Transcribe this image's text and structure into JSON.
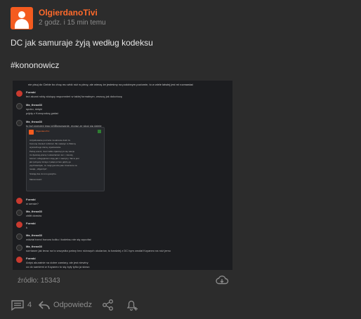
{
  "post": {
    "author": "OlgierdanoTivi",
    "time": "2 godz. i 15 min temu",
    "text": "DC jak samuraje żyją według kodeksu",
    "tag": "#kononowicz",
    "source": "źródło: 15343"
  },
  "screenshot": {
    "header": "nie pisuj do Cieble bo chcę mu wbić nóż w plecy, ale wierzę że jesteśmy na podobnym poziomie, to w wiele łatwiej jest mi rozmawiać",
    "messages": [
      {
        "author": "Formbi",
        "lines": [
          "też akurat robię służący wspomnień w takiej formalnym, wrzucę jak dokończę"
        ]
      },
      {
        "author": "Ma_theoa33",
        "lines": [
          "spoko, dzięki",
          "pójdę z Konopodzą gadać"
        ]
      },
      {
        "author": "Ma_theoa33",
        "lines": [
          "to był przecież jego ichBlowowanie, moraz ze skoć się dzieje"
        ]
      },
      {
        "author": "Formbi",
        "lines": [
          "w sensie?"
        ]
      },
      {
        "author": "Ma_theoa33",
        "lines": [
          "chłitt domów"
        ]
      },
      {
        "author": "Formbi",
        "lines": [
          "k"
        ]
      },
      {
        "author": "Ma_theoa33",
        "lines": [
          "widział trzeci honoru kolku i kodeksu nie się wycofać"
        ]
      },
      {
        "author": "Ma_theoa33",
        "lines": [
          "sorriasne jak teraz na to wszystko patrzy bez różowych okularów, to bardziej z DC bym zwołał Koyaneo na nóż jemu"
        ]
      },
      {
        "author": "Formbi",
        "lines": [
          "Antyś akuratnie na dobre zamiary, ale jest niewiny",
          "co do samiemi w Koyaneo to się były tylko ja słowo"
        ]
      }
    ],
    "quote": {
      "author": "OlgierdanoTivi",
      "lines": [
        "Antyśdowanie poczucie na akcesie dotór że",
        "Komunę również rozliczeń. Bo naświęc to Wiłomy",
        "wyszedł tego dumą, wyartowania.",
        "Pełnej anonii, rzecz kólko cijaścią tym się wiecje",
        "za dywanej-pracą z uwiaszaniem ten i, niesoty,",
        "bokruz i szłegojaniem stoję jak z maszyny. Tak to jest",
        "jak tycisywą mimigo z jakąć-przeto gdyby go",
        "psychotantyku, co mógł gonuzie jako znaszenie na",
        "reeaje, „objęsniya\".",
        "",
        "Szałuję tkie do toru gosiybre.",
        "",
        "Marcenowicz"
      ]
    }
  },
  "actions": {
    "comments_count": "4",
    "reply_label": "Odpowiedz"
  },
  "colors": {
    "background": "#2c2c2c",
    "accent": "#ff6a2b",
    "muted": "#8c8c8c"
  },
  "icons": [
    "user-icon",
    "cloud-download-icon",
    "comment-icon",
    "reply-icon",
    "share-icon",
    "bell-plus-icon"
  ]
}
